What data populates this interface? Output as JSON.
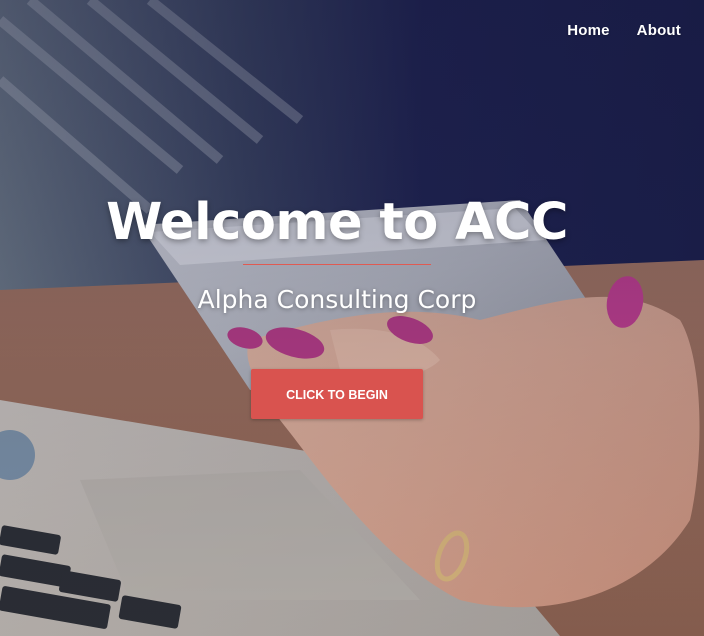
{
  "nav": {
    "items": [
      {
        "label": "Home"
      },
      {
        "label": "About"
      }
    ]
  },
  "hero": {
    "title": "Welcome to ACC",
    "subtitle": "Alpha Consulting Corp",
    "cta_label": "CLICK TO BEGIN",
    "background": "photo of a hand with pink nail polish holding a smartphone over a laptop"
  },
  "colors": {
    "accent": "#d9534f",
    "divider": "#e05a52",
    "text": "#ffffff"
  }
}
